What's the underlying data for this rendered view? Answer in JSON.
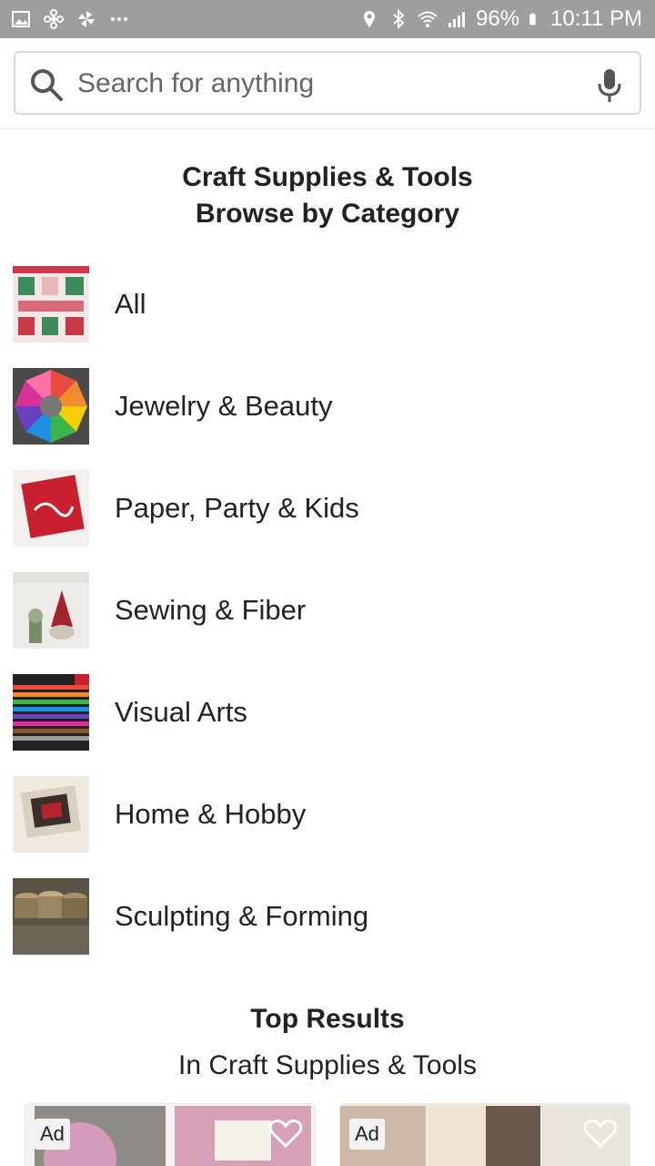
{
  "status_bar": {
    "battery": "96%",
    "time": "10:11 PM",
    "icons": [
      "gallery-icon",
      "pinwheel-icon",
      "fan-icon",
      "more-icon",
      "location-icon",
      "bluetooth-icon",
      "wifi-icon",
      "signal-icon",
      "battery-icon"
    ]
  },
  "search": {
    "placeholder": "Search for anything"
  },
  "heading": {
    "title": "Craft Supplies & Tools",
    "subtitle": "Browse by Category"
  },
  "categories": [
    {
      "label": "All",
      "thumb": "all-thumbnail"
    },
    {
      "label": "Jewelry & Beauty",
      "thumb": "jewelry-beauty-thumbnail"
    },
    {
      "label": "Paper, Party & Kids",
      "thumb": "paper-party-kids-thumbnail"
    },
    {
      "label": "Sewing & Fiber",
      "thumb": "sewing-fiber-thumbnail"
    },
    {
      "label": "Visual Arts",
      "thumb": "visual-arts-thumbnail"
    },
    {
      "label": "Home & Hobby",
      "thumb": "home-hobby-thumbnail"
    },
    {
      "label": "Sculpting & Forming",
      "thumb": "sculpting-forming-thumbnail"
    }
  ],
  "results": {
    "title": "Top Results",
    "subtitle": "In Craft Supplies & Tools",
    "cards": [
      {
        "badge": "Ad"
      },
      {
        "badge": "Ad"
      }
    ]
  },
  "colors": {
    "status_bar_bg": "#9e9e9e",
    "text": "#222222"
  }
}
